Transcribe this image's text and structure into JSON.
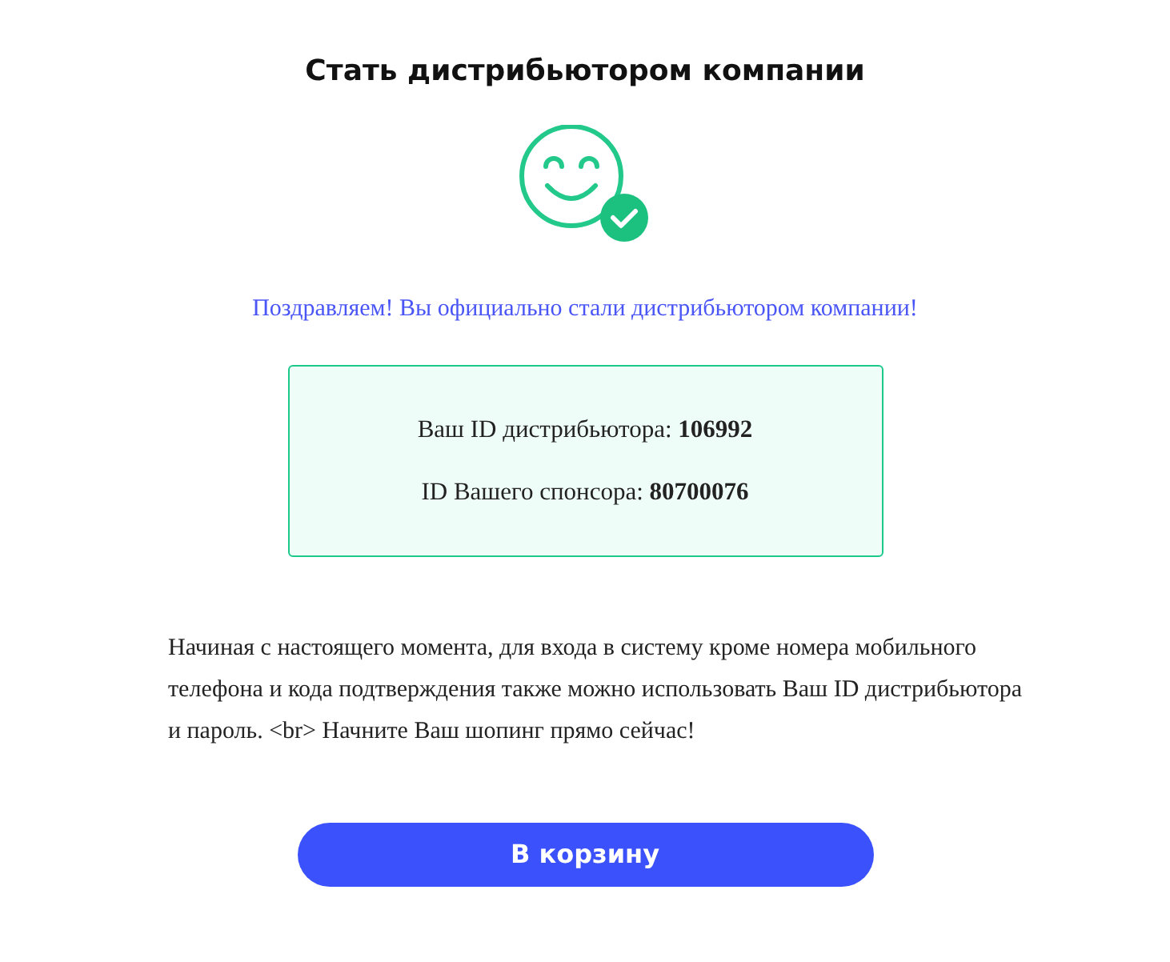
{
  "title": "Стать дистрибьютором компании",
  "message": "Поздравляем! Вы официально стали дистрибьютором компании!",
  "ids": [
    {
      "text": "Ваш ID дистрибьютора: **106992**"
    },
    {
      "text": "ID Вашего спонсора: **80700076**"
    }
  ],
  "description": "Начиная с настоящего момента, для входа в систему кроме номера мобильного телефона и кода подтверждения также можно использовать Ваш ID дистрибьютора и пароль. <br> Начните Ваш шопинг прямо сейчас!",
  "button": "В корзину"
}
